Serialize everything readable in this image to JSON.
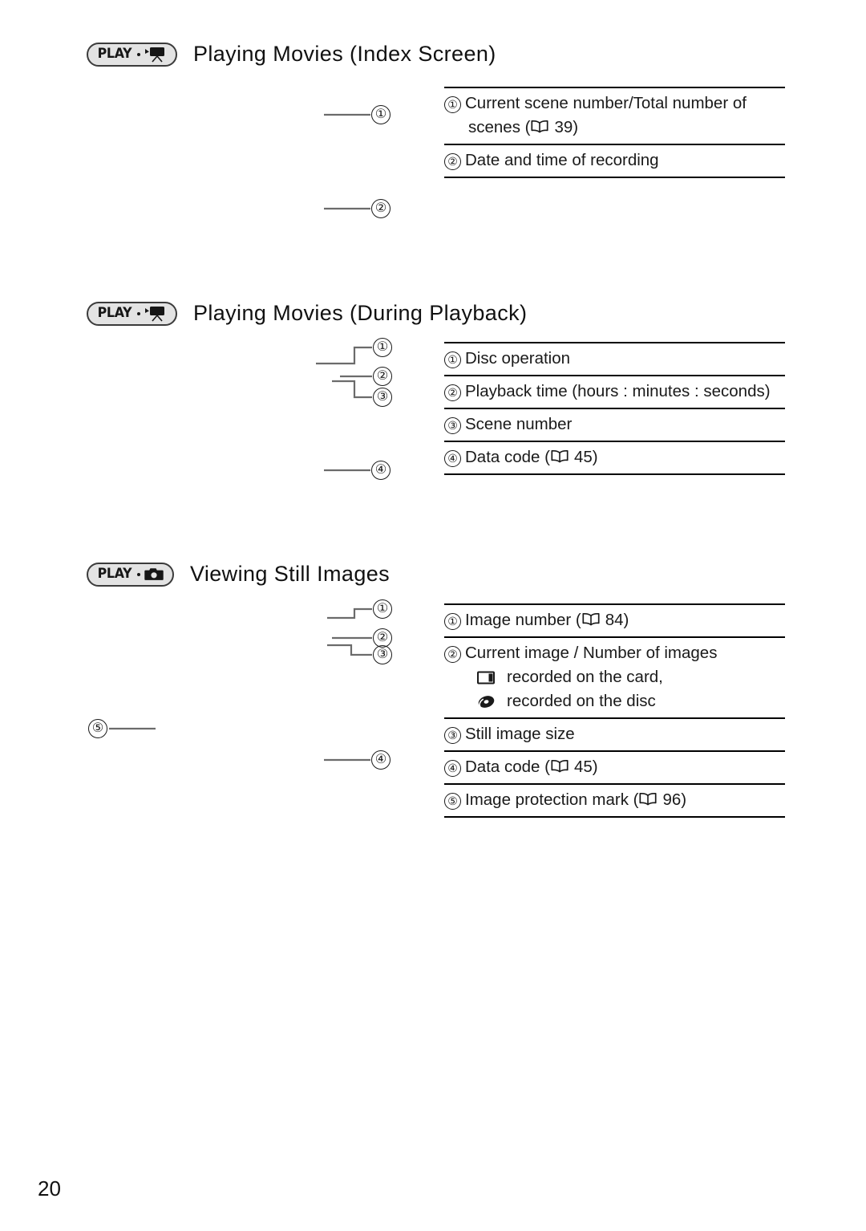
{
  "page": {
    "number": "20"
  },
  "sections": [
    {
      "id": "playing-movies-index",
      "badge": {
        "text": "PLAY",
        "icon": "camcorder-icon"
      },
      "title": "Playing Movies (Index Screen)",
      "callouts": [
        {
          "marker": "①",
          "lines": [
            {
              "text": "Current scene number/Total number of"
            },
            {
              "text": "scenes (",
              "ref_icon": "book-icon",
              "ref_page": "39",
              "text_after": ")",
              "indent": true
            }
          ]
        },
        {
          "marker": "②",
          "lines": [
            {
              "text": "Date and time of recording"
            }
          ]
        }
      ],
      "leaders": [
        {
          "label": "①"
        },
        {
          "label": "②"
        }
      ]
    },
    {
      "id": "playing-movies-during-playback",
      "badge": {
        "text": "PLAY",
        "icon": "camcorder-icon"
      },
      "title": "Playing Movies (During Playback)",
      "callouts": [
        {
          "marker": "①",
          "lines": [
            {
              "text": "Disc operation"
            }
          ]
        },
        {
          "marker": "②",
          "lines": [
            {
              "text": "Playback time (hours : minutes : seconds)"
            }
          ]
        },
        {
          "marker": "③",
          "lines": [
            {
              "text": "Scene number"
            }
          ]
        },
        {
          "marker": "④",
          "lines": [
            {
              "text": "Data code (",
              "ref_icon": "book-icon",
              "ref_page": "45",
              "text_after": ")"
            }
          ]
        }
      ],
      "leaders": [
        {
          "label": "①"
        },
        {
          "label": "②"
        },
        {
          "label": "③"
        },
        {
          "label": "④"
        }
      ]
    },
    {
      "id": "viewing-still-images",
      "badge": {
        "text": "PLAY",
        "icon": "photo-camera-icon"
      },
      "title": "Viewing Still Images",
      "callouts": [
        {
          "marker": "①",
          "lines": [
            {
              "text": "Image number (",
              "ref_icon": "book-icon",
              "ref_page": "84",
              "text_after": ")"
            }
          ]
        },
        {
          "marker": "②",
          "lines": [
            {
              "text": "Current image / Number of images"
            },
            {
              "media_icon": "memory-card-icon",
              "text": "recorded on the card,"
            },
            {
              "media_icon": "disc-icon",
              "text": "recorded on the disc"
            }
          ]
        },
        {
          "marker": "③",
          "lines": [
            {
              "text": "Still image size"
            }
          ]
        },
        {
          "marker": "④",
          "lines": [
            {
              "text": "Data code (",
              "ref_icon": "book-icon",
              "ref_page": "45",
              "text_after": ")"
            }
          ]
        },
        {
          "marker": "⑤",
          "lines": [
            {
              "text": "Image protection mark (",
              "ref_icon": "book-icon",
              "ref_page": "96",
              "text_after": ")"
            }
          ]
        }
      ],
      "leaders": [
        {
          "label": "①"
        },
        {
          "label": "②"
        },
        {
          "label": "③"
        },
        {
          "label": "④"
        },
        {
          "label": "⑤"
        }
      ]
    }
  ]
}
